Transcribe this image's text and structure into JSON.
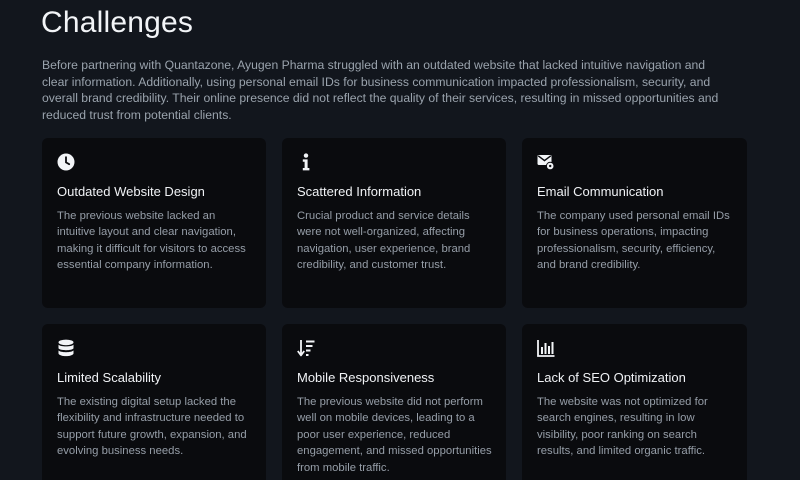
{
  "section": {
    "title": "Challenges",
    "intro": "Before partnering with Quantazone, Ayugen Pharma struggled with an outdated website that lacked intuitive navigation and clear information. Additionally, using personal email IDs for business communication impacted professionalism, security, and overall brand credibility. Their online presence did not reflect the quality of their services, resulting in missed opportunities and reduced trust from potential clients."
  },
  "cards": [
    {
      "icon": "clock-icon",
      "title": "Outdated Website Design",
      "text": "The previous website lacked an intuitive layout and clear navigation, making it difficult for visitors to access essential company information."
    },
    {
      "icon": "info-icon",
      "title": "Scattered Information",
      "text": "Crucial product and service details were not well-organized, affecting navigation, user experience, brand credibility, and customer trust."
    },
    {
      "icon": "mail-gear-icon",
      "title": "Email Communication",
      "text": "The company used personal email IDs for business operations, impacting professionalism, security, efficiency, and brand credibility."
    },
    {
      "icon": "database-icon",
      "title": "Limited Scalability",
      "text": "The existing digital setup lacked the flexibility and infrastructure needed to support future growth, expansion, and evolving business needs."
    },
    {
      "icon": "sort-down-icon",
      "title": "Mobile Responsiveness",
      "text": "The previous website did not perform well on mobile devices, leading to a poor user experience, reduced engagement, and missed opportunities from mobile traffic."
    },
    {
      "icon": "bar-chart-icon",
      "title": "Lack of SEO Optimization",
      "text": "The website was not optimized for search engines, resulting in low visibility, poor ranking on search results, and limited organic traffic."
    }
  ],
  "colors": {
    "background": "#12161d",
    "card": "#0a0b0e",
    "heading": "#f2f4f7",
    "body_text": "#969ea8"
  }
}
